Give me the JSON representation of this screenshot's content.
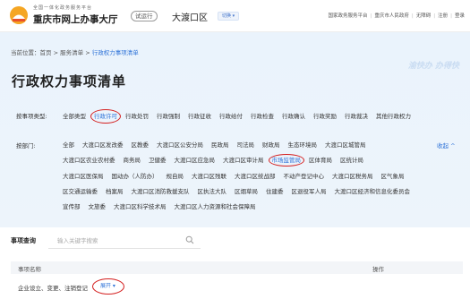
{
  "header": {
    "site_subtitle": "全国一体化政务服务平台",
    "site_title": "重庆市网上办事大厅",
    "region_badge": "试运行",
    "region_name": "大渡口区",
    "switch_label": "切换 ▾",
    "links": [
      "国家政务服务平台",
      "重庆市人民政府",
      "无障碍",
      "注册",
      "登录"
    ]
  },
  "breadcrumb": {
    "prefix": "当前位置：",
    "items": [
      "首页",
      "服务清单",
      "行政权力事项清单"
    ],
    "separator": ">"
  },
  "watermark": "渝快办 办得快",
  "page_title": "行政权力事项清单",
  "filters": {
    "type_label": "按事项类型:",
    "types": [
      "全部类型",
      "行政许可",
      "行政处罚",
      "行政强制",
      "行政征收",
      "行政给付",
      "行政检查",
      "行政确认",
      "行政奖励",
      "行政裁决",
      "其他行政权力"
    ],
    "active_type": "行政许可",
    "dept_label": "按部门:",
    "collapse_label": "收起 ^",
    "dept_rows": [
      [
        "全部",
        "大渡口区发改委",
        "区教委",
        "大渡口区公安分局",
        "民政局",
        "司法局",
        "财政局",
        "生态环境局",
        "大渡口区城管局"
      ],
      [
        "大渡口区农业农村委",
        "商务局",
        "卫健委",
        "大渡口区应急局",
        "大渡口区审计局",
        "市场监管局",
        "区体育局",
        "区统计局"
      ],
      [
        "大渡口区医保局",
        "国动办（人防办）",
        "规自局",
        "大渡口区残联",
        "大渡口区统战部",
        "不动产登记中心",
        "大渡口区税务局",
        "区气象局"
      ],
      [
        "区交通运输委",
        "档案局",
        "大渡口区消防救援支队",
        "区执法大队",
        "区烟草局",
        "住建委",
        "区退役军人局",
        "大渡口区经济和信息化委员会"
      ],
      [
        "宣传部",
        "文旅委",
        "大渡口区科学技术局",
        "大渡口区人力资源和社会保障局"
      ]
    ],
    "active_dept": "市场监管局"
  },
  "search": {
    "label": "事项查询",
    "placeholder": "输入关键字搜索",
    "value": ""
  },
  "table": {
    "col_name": "事项名称",
    "col_op": "操作",
    "rows": [
      {
        "name": "企业设立、变更、注销登记",
        "expand_label": "展开 ▾"
      }
    ]
  }
}
